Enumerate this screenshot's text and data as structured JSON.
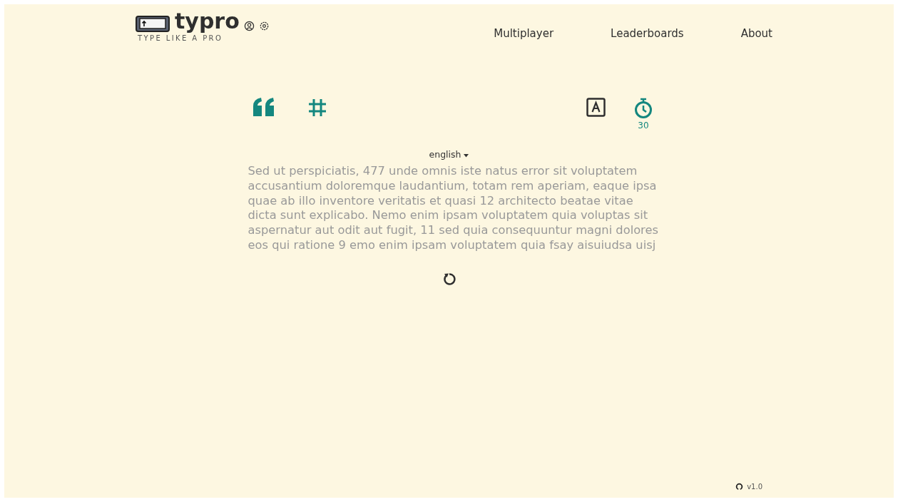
{
  "logo": {
    "name": "typro",
    "tagline": "TYPE LIKE A PRO"
  },
  "nav": [
    {
      "label": "Multiplayer"
    },
    {
      "label": "Leaderboards"
    },
    {
      "label": "About"
    }
  ],
  "modes": [
    {
      "kind": "quote",
      "selected": true
    },
    {
      "kind": "hash",
      "selected": true
    },
    {
      "kind": "letter",
      "selected": false
    },
    {
      "kind": "timer",
      "selected": true,
      "caption": "30"
    }
  ],
  "language": "english",
  "text_lines": [
    "Sed ut perspiciatis, 477 unde omnis iste natus error sit voluptatem",
    "accusantium doloremque laudantium, totam rem aperiam, eaque ipsa",
    "quae ab illo inventore veritatis et quasi 12 architecto beatae vitae",
    "dicta sunt explicabo. Nemo enim ipsam voluptatem quia voluptas sit",
    "aspernatur aut odit aut fugit, 11 sed quia consequuntur magni dolores",
    "eos qui ratione 9 emo enim ipsam voluptatem quia fsay aisuiudsa uisj"
  ],
  "version": "v1.0"
}
